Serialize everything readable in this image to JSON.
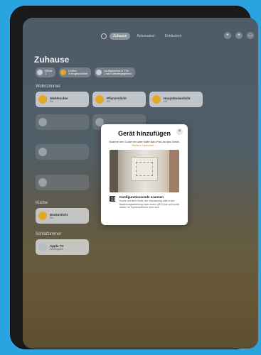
{
  "toolbar": {
    "tabs": [
      "Zuhause",
      "Automation",
      "Entdecken"
    ],
    "active_tab": 0
  },
  "title": "Zuhause",
  "chips": [
    {
      "label": "Klima",
      "value": "1"
    },
    {
      "label": "Lichter",
      "value": "3 eingeschaltet"
    },
    {
      "label": "Lautsprecher & TVs",
      "value": "1 wird wiedergegeben"
    }
  ],
  "sections": {
    "wohnzimmer": "Wohnzimmer",
    "kueche": "Küche",
    "schlafzimmer": "Schlafzimmer"
  },
  "tiles": {
    "stehleuchte": {
      "name": "Stehleuchte",
      "state": "Ein"
    },
    "pflanzenlicht": {
      "name": "Pflanzenlicht",
      "state": "Ein"
    },
    "hauptdeckenlicht": {
      "name": "Hauptdeckenlicht",
      "state": "Ein"
    },
    "deckenlicht": {
      "name": "Deckenlicht",
      "state": "Ein"
    },
    "appletv": {
      "name": "Apple TV",
      "state": "Wiedergabe"
    }
  },
  "modal": {
    "title": "Gerät hinzufügen",
    "subtitle": "Scanne den Code ein oder halte das iPad an das Gerät.",
    "more_options": "Weitere Optionen ...",
    "scan_title": "Konfigurationscode scannen",
    "scan_desc": "Suche auf dem Gerät, der Verpackung oder in der Bedienungsanleitung nach einem QR-Code und richte diesen im Kamerarahmen oben aus.",
    "close_icon": "×"
  }
}
